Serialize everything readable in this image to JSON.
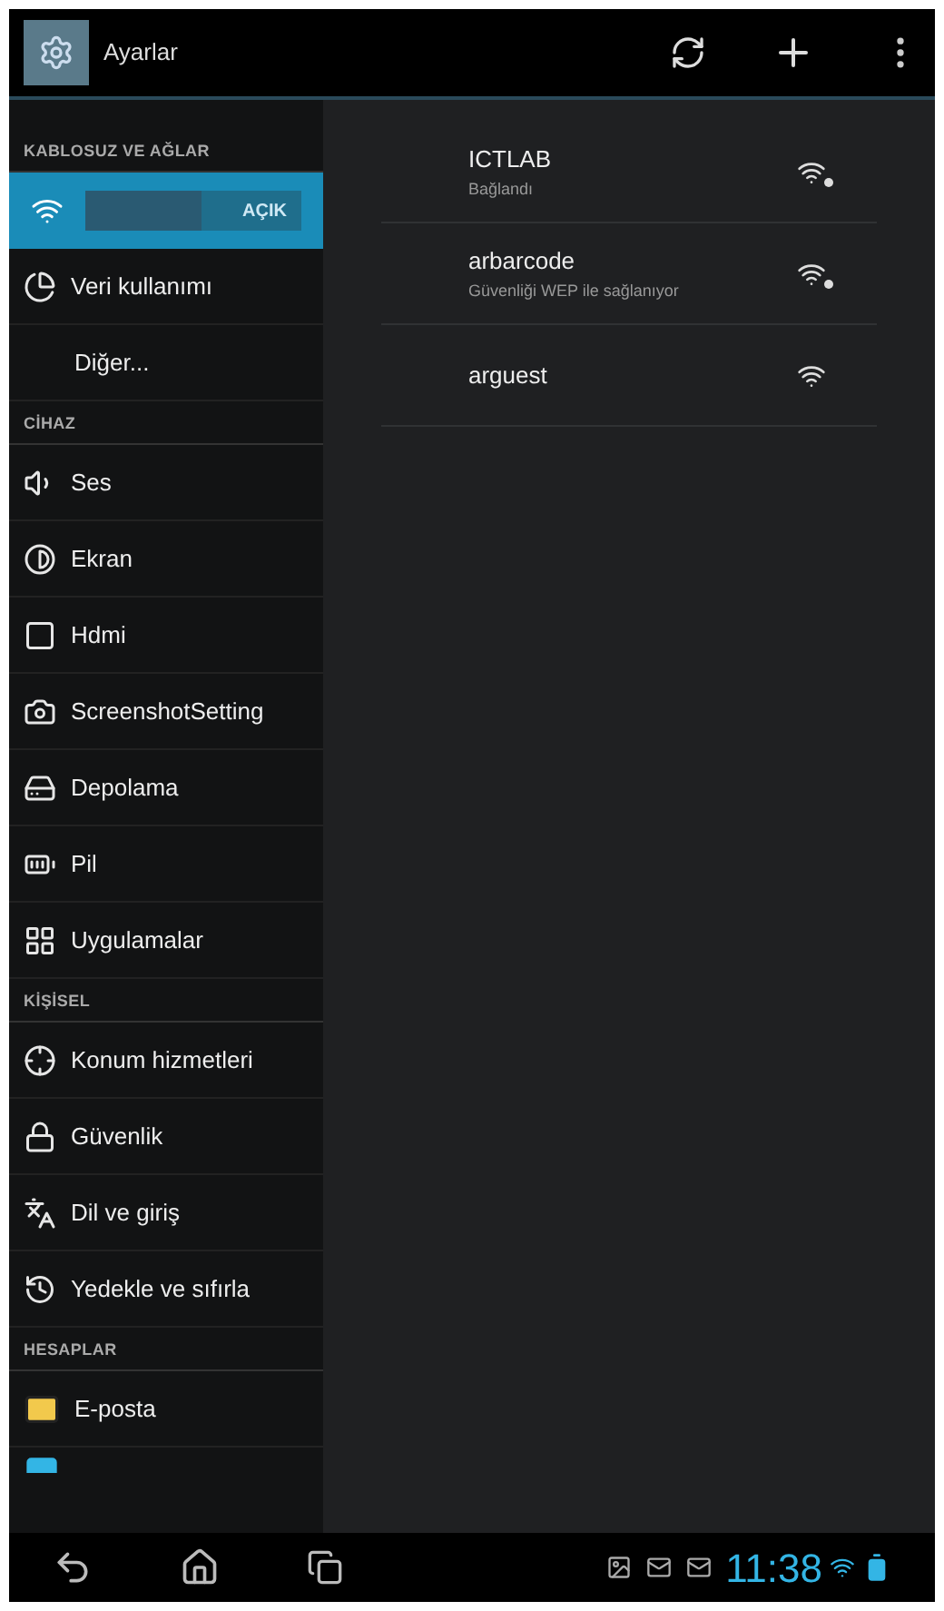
{
  "action_bar": {
    "title": "Ayarlar"
  },
  "sidebar": {
    "items": [
      {
        "kind": "header",
        "label": "KABLOSUZ VE AĞLAR"
      },
      {
        "kind": "wifi",
        "selected": true,
        "switch": {
          "on": true,
          "label": "AÇIK"
        }
      },
      {
        "kind": "item",
        "label": "Veri kullanımı",
        "selected": false
      },
      {
        "kind": "item",
        "label": "Diğer...",
        "selected": false
      },
      {
        "kind": "header",
        "label": "CİHAZ"
      },
      {
        "kind": "item",
        "label": "Ses",
        "selected": false
      },
      {
        "kind": "item",
        "label": "Ekran",
        "selected": false
      },
      {
        "kind": "item",
        "label": "Hdmi",
        "selected": false
      },
      {
        "kind": "item",
        "label": "ScreenshotSetting",
        "selected": false
      },
      {
        "kind": "item",
        "label": "Depolama",
        "selected": false
      },
      {
        "kind": "item",
        "label": "Pil",
        "selected": false
      },
      {
        "kind": "item",
        "label": "Uygulamalar",
        "selected": false
      },
      {
        "kind": "header",
        "label": "KİŞİSEL"
      },
      {
        "kind": "item",
        "label": "Konum hizmetleri",
        "selected": false
      },
      {
        "kind": "item",
        "label": "Güvenlik",
        "selected": false
      },
      {
        "kind": "item",
        "label": "Dil ve giriş",
        "selected": false
      },
      {
        "kind": "item",
        "label": "Yedekle ve sıfırla",
        "selected": false
      },
      {
        "kind": "header",
        "label": "HESAPLAR"
      },
      {
        "kind": "item",
        "label": "E-posta",
        "selected": false
      },
      {
        "kind": "partial"
      }
    ]
  },
  "networks": [
    {
      "name": "ICTLAB",
      "status": "Bağlandı",
      "secured": true
    },
    {
      "name": "arbarcode",
      "status": "Güvenliği WEP ile sağlanıyor",
      "secured": true
    },
    {
      "name": "arguest",
      "secured": false
    }
  ],
  "status_bar": {
    "time": "11:38"
  }
}
